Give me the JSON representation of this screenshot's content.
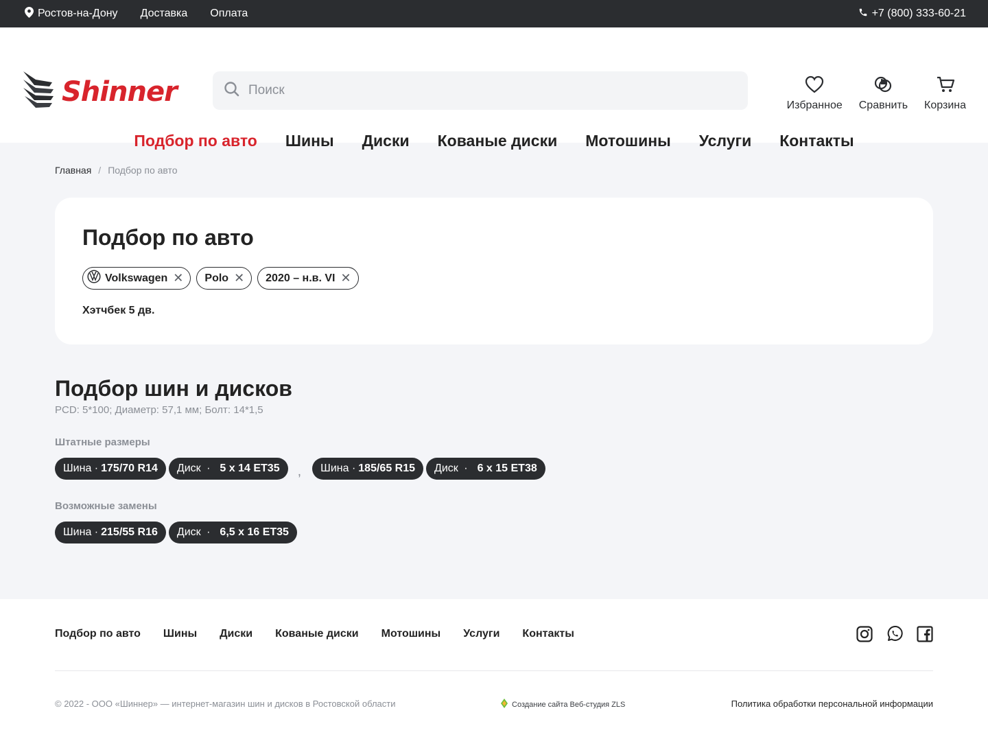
{
  "topbar": {
    "city": "Ростов-на-Дону",
    "delivery": "Доставка",
    "payment": "Оплата",
    "phone": "+7 (800) 333-60-21"
  },
  "header": {
    "logo": "Shinner",
    "search_placeholder": "Поиск",
    "favorites": "Избранное",
    "compare": "Сравнить",
    "cart": "Корзина"
  },
  "nav": {
    "items": [
      "Подбор по авто",
      "Шины",
      "Диски",
      "Кованые диски",
      "Мотошины",
      "Услуги",
      "Контакты"
    ],
    "active": "Подбор по авто"
  },
  "breadcrumb": {
    "home": "Главная",
    "separator": "/",
    "current": "Подбор по авто"
  },
  "selection": {
    "title": "Подбор по авто",
    "chips": [
      "Volkswagen",
      "Polo",
      "2020 – н.в. VI"
    ],
    "body_type": "Хэтчбек 5 дв."
  },
  "fitment": {
    "title": "Подбор шин и дисков",
    "specs": "PCD: 5*100; Диаметр: 57,1 мм; Болт: 14*1,5",
    "standard_label": "Штатные размеры",
    "separator": ",",
    "standard": [
      {
        "tire_label": "Шина",
        "tire": "175/70 R14",
        "disk_label": "Диск",
        "disk": "5 x 14 ET35"
      },
      {
        "tire_label": "Шина",
        "tire": "185/65 R15",
        "disk_label": "Диск",
        "disk": "6 x 15 ET38"
      }
    ],
    "replacements_label": "Возможные замены",
    "replacements": [
      {
        "tire_label": "Шина",
        "tire": "215/55 R16",
        "disk_label": "Диск",
        "disk": "6,5 x 16 ET35"
      }
    ]
  },
  "footer": {
    "nav": [
      "Подбор по авто",
      "Шины",
      "Диски",
      "Кованые диски",
      "Мотошины",
      "Услуги",
      "Контакты"
    ],
    "social": [
      "instagram-icon",
      "whatsapp-icon",
      "facebook-icon"
    ],
    "copyright": "© 2022 - ООО «Шиннер» — интернет-магазин шин и дисков в Ростовской области",
    "studio": "Создание сайта Веб-студия ZLS",
    "policy": "Политика обработки персональной информации"
  },
  "colors": {
    "accent": "#d8242c",
    "dark": "#2b2d30",
    "background": "#f4f5f8"
  }
}
